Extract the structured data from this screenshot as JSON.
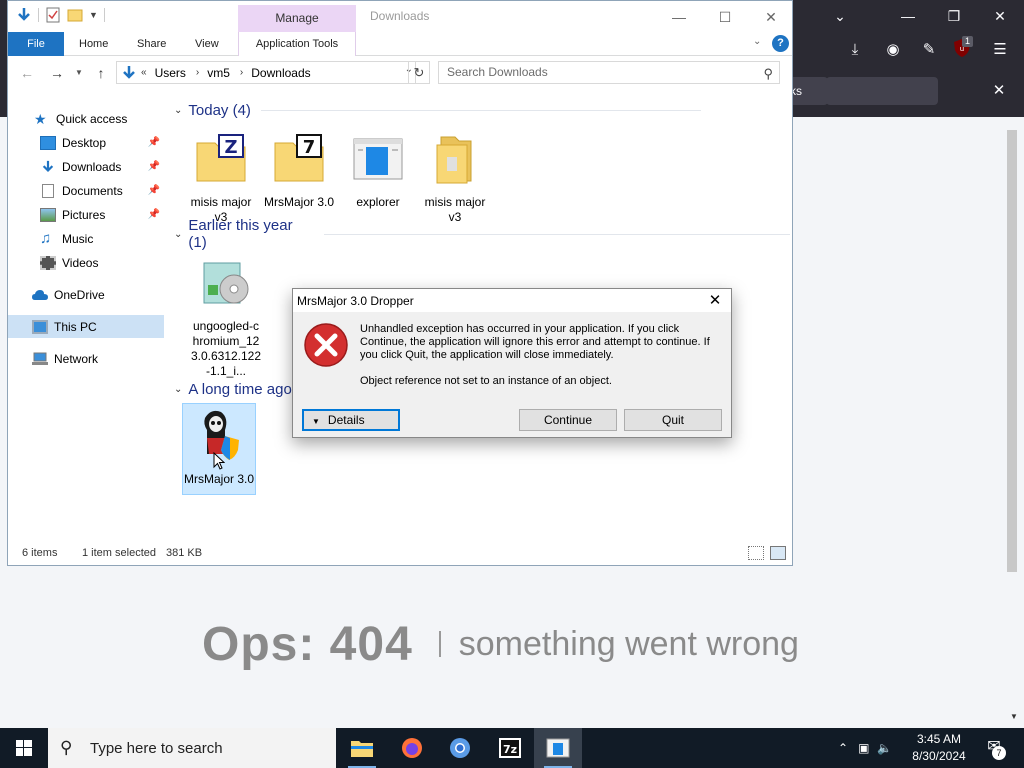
{
  "browser": {
    "findbar_fragment": "ks",
    "notification_count": "1",
    "error_code": "Ops: 404",
    "error_message": "something went wrong"
  },
  "explorer": {
    "title": "Downloads",
    "ribbon": {
      "manage": "Manage",
      "tabs": [
        "File",
        "Home",
        "Share",
        "View",
        "Application Tools"
      ],
      "help": "?"
    },
    "address": {
      "crumbs": [
        "Users",
        "vm5",
        "Downloads"
      ],
      "overflow": "«",
      "search_placeholder": "Search Downloads"
    },
    "nav": {
      "quick_access": "Quick access",
      "desktop": "Desktop",
      "downloads": "Downloads",
      "documents": "Documents",
      "pictures": "Pictures",
      "music": "Music",
      "videos": "Videos",
      "onedrive": "OneDrive",
      "this_pc": "This PC",
      "network": "Network"
    },
    "groups": {
      "today": "Today (4)",
      "earlier": "Earlier this year (1)",
      "long_ago": "A long time ago"
    },
    "files": {
      "today": [
        {
          "label": "misis major v3",
          "icon": "zip-archive-icon"
        },
        {
          "label": "MrsMajor 3.0",
          "icon": "7z-archive-icon"
        },
        {
          "label": "explorer",
          "icon": "application-window-icon"
        },
        {
          "label": "misis major v3",
          "icon": "folder-icon"
        }
      ],
      "earlier": [
        {
          "label": "ungoogled-chromium_123.0.6312.122-1.1_i...",
          "icon": "installer-disc-icon"
        }
      ],
      "long_ago": [
        {
          "label": "MrsMajor 3.0",
          "icon": "skull-shield-icon"
        }
      ]
    },
    "status": {
      "count": "6 items",
      "selection": "1 item selected",
      "size": "381 KB"
    }
  },
  "dialog": {
    "title": "MrsMajor 3.0 Dropper",
    "message": "Unhandled exception has occurred in your application. If you click Continue, the application will ignore this error and attempt to continue. If you click Quit, the application will close immediately.",
    "detail": "Object reference not set to an instance of an object.",
    "details_button": "Details",
    "continue_button": "Continue",
    "quit_button": "Quit"
  },
  "taskbar": {
    "search_placeholder": "Type here to search",
    "time": "3:45 AM",
    "date": "8/30/2024",
    "notification_count": "7"
  },
  "colors": {
    "file_tab": "#1e73c2",
    "manage_tab": "#ebd6f5",
    "selection": "#cce8ff",
    "error_red": "#d32f2f",
    "taskbar": "#111b26",
    "browser_chrome": "#2b2a33"
  }
}
